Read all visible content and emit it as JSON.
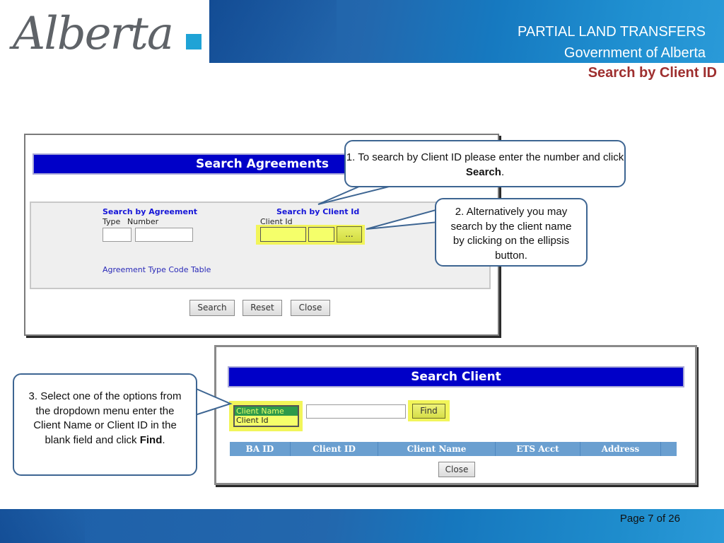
{
  "header": {
    "logo_text": "Alberta",
    "title_line1": "PARTIAL LAND TRANSFERS",
    "title_line2": "Government of Alberta",
    "subtitle": "Search by Client ID"
  },
  "colors": {
    "brand_blue": "#1d5fa8",
    "subtitle_red": "#9e2f2f",
    "banner_blue": "#0000c8",
    "highlight_yellow": "#f2f55a",
    "callout_border": "#3d6592"
  },
  "search_agreements": {
    "title": "Search Agreements",
    "by_agreement": {
      "section_title": "Search by Agreement",
      "type_label": "Type",
      "number_label": "Number",
      "type_value": "",
      "number_value": ""
    },
    "by_client": {
      "section_title": "Search by Client Id",
      "client_id_label": "Client Id",
      "client_id_value": "",
      "client_id_suffix_value": "",
      "ellipsis_label": "..."
    },
    "code_table_link": "Agreement Type Code Table",
    "buttons": {
      "search": "Search",
      "reset": "Reset",
      "close": "Close"
    }
  },
  "search_client": {
    "title": "Search Client",
    "search_type_options": [
      "Client Name",
      "Client Id"
    ],
    "selected_option": "Client Name",
    "search_value": "",
    "find_label": "Find",
    "table_headers": [
      "BA ID",
      "Client ID",
      "Client Name",
      "ETS Acct",
      "Address"
    ],
    "close_label": "Close"
  },
  "callouts": {
    "step1_pre": "1. To search by Client ID please enter the number and click ",
    "step1_bold": "Search",
    "step1_post": ".",
    "step2": "2.  Alternatively you may search by the client name by clicking on the ellipsis button.",
    "step3_pre": "3.  Select one of the options from the dropdown menu enter the Client Name or Client ID in the blank field and click ",
    "step3_bold": "Find",
    "step3_post": "."
  },
  "footer": {
    "page_label": "Page 7 of 26"
  }
}
